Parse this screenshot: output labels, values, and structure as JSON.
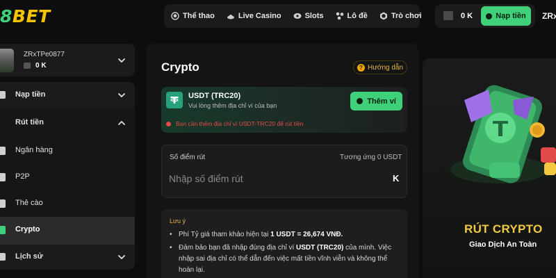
{
  "brand": {
    "logo_text": "BET",
    "accent": "#3fd17a",
    "gold": "#f5c400"
  },
  "nav": {
    "items": [
      {
        "label": "Thể thao",
        "icon": "sports-icon"
      },
      {
        "label": "Live Casino",
        "icon": "casino-icon"
      },
      {
        "label": "Slots",
        "icon": "slots-icon"
      },
      {
        "label": "Lô đề",
        "icon": "lottery-icon"
      },
      {
        "label": "Trò chơi",
        "icon": "games-icon"
      }
    ]
  },
  "wallet": {
    "balance": "0 K",
    "deposit_label": "Nạp tiền"
  },
  "header_user": "ZRx",
  "sidebar": {
    "username": "ZRxTPe0877",
    "balance": "0 K",
    "menu": {
      "deposit": "Nạp tiền",
      "withdraw": "Rút tiền",
      "sub_items": [
        {
          "label": "Ngân hàng",
          "active": false
        },
        {
          "label": "P2P",
          "active": false
        },
        {
          "label": "Thẻ cào",
          "active": false
        },
        {
          "label": "Crypto",
          "active": true
        }
      ],
      "history": "Lịch sử"
    }
  },
  "main": {
    "title": "Crypto",
    "guide_label": "Hướng dẫn",
    "usdt": {
      "name": "USDT (TRC20)",
      "subtitle": "Vui lòng thêm địa chỉ ví của bạn",
      "add_wallet_label": "Thêm ví",
      "warning": "Bạn cần thêm địa chỉ ví USDT-TRC20 để rút tiền"
    },
    "amount": {
      "label": "Số điểm rút",
      "equivalent": "Tương ứng 0 USDT",
      "placeholder": "Nhập số điểm rút",
      "suffix": "K"
    },
    "notes": {
      "title": "Lưu ý",
      "rate_prefix": "Phí Tỷ giá tham khảo hiện tại ",
      "rate_value": "1 USDT = 26,674 VNĐ.",
      "warn_prefix": "Đảm bảo bạn đã nhập đúng địa chỉ ví ",
      "warn_bold": "USDT (TRC20)",
      "warn_suffix": " của mình. Việc nhập sai địa chỉ có thể dẫn đến việc mất tiền vĩnh viễn và không thể hoàn lại."
    }
  },
  "promo": {
    "title": "RÚT CRYPTO",
    "subtitle": "Giao Dịch An Toàn"
  }
}
